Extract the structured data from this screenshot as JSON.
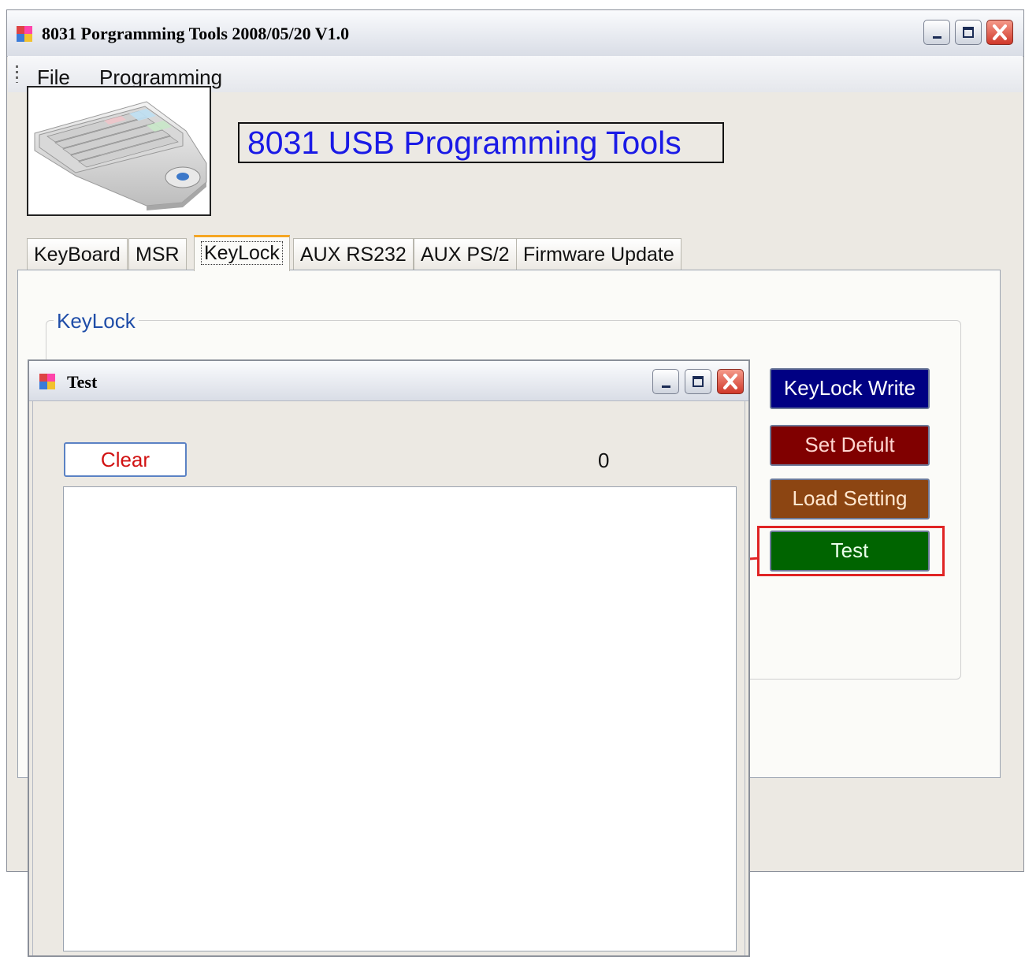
{
  "main_window": {
    "title": "8031 Porgramming Tools 2008/05/20 V1.0",
    "menu": [
      "File",
      "Programming"
    ],
    "heading": "8031 USB Programming Tools",
    "tabs": [
      "KeyBoard",
      "MSR",
      "KeyLock",
      "AUX RS232",
      "AUX PS/2",
      "Firmware Update"
    ],
    "active_tab": "KeyLock",
    "group_label": "KeyLock",
    "buttons": {
      "keylock_write": "KeyLock Write",
      "set_default": "Set Defult",
      "load_setting": "Load Setting",
      "test": "Test"
    }
  },
  "test_window": {
    "title": "Test",
    "clear_label": "Clear",
    "counter": "0",
    "log_text": ""
  },
  "colors": {
    "heading_text": "#1a1ae6",
    "write_button": "#000083",
    "default_button": "#800000",
    "load_button": "#8c4512",
    "test_button": "#006400",
    "annotation": "#e02424"
  },
  "icons": [
    "app-icon",
    "minimize-icon",
    "maximize-icon",
    "close-icon",
    "keyboard-image"
  ]
}
